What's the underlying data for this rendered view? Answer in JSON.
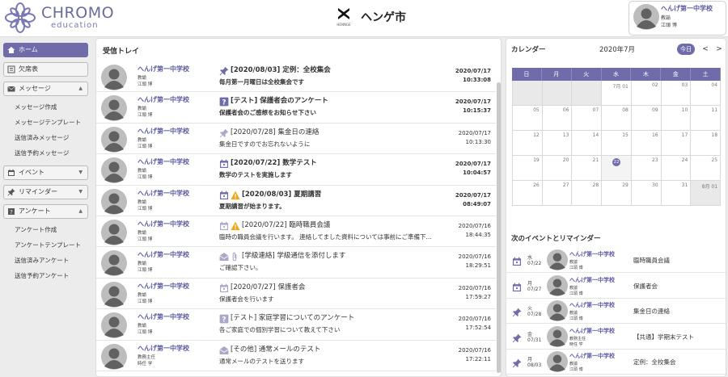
{
  "header": {
    "brand": "CHROMO",
    "brand_sub": "education",
    "city_sub": "HENNGE",
    "city_name": "ヘンゲ市",
    "user": {
      "school": "へんげ第一中学校",
      "role": "教諭",
      "person": "江頭 博"
    }
  },
  "sidebar": {
    "home": "ホーム",
    "attendance": "欠席表",
    "messages": "メッセージ",
    "message_items": [
      "メッセージ作成",
      "メッセージテンプレート",
      "送信済みメッセージ",
      "送信予約メッセージ"
    ],
    "events": "イベント",
    "reminders": "リマインダー",
    "surveys": "アンケート",
    "survey_items": [
      "アンケート作成",
      "アンケートテンプレート",
      "送信済みアンケート",
      "送信予約アンケート"
    ]
  },
  "inbox": {
    "title": "受信トレイ",
    "messages": [
      {
        "school": "へんげ第一中学校",
        "role": "教諭",
        "person": "江頭 博",
        "icons": [
          "pin-icon"
        ],
        "subject": "[2020/08/03] 定例：全校集会",
        "preview": "毎月第一月曜日は全校集会です",
        "date": "2020/07/17",
        "time": "10:33:08",
        "unread": true
      },
      {
        "school": "へんげ第一中学校",
        "role": "教諭",
        "person": "江頭 博",
        "icons": [
          "survey-icon"
        ],
        "subject": "[テスト] 保護者会のアンケート",
        "preview": "保護者会のご感想をお知らせ下さい",
        "date": "2020/07/17",
        "time": "10:15:37",
        "unread": true
      },
      {
        "school": "へんげ第一中学校",
        "role": "教諭",
        "person": "江頭 博",
        "icons": [
          "pin-icon"
        ],
        "subject": "[2020/07/28] 集金日の連絡",
        "preview": "集金日ですのでお忘れないように",
        "date": "2020/07/17",
        "time": "10:13:30",
        "unread": false
      },
      {
        "school": "へんげ第一中学校",
        "role": "教諭",
        "person": "江頭 博",
        "icons": [
          "calendar-icon"
        ],
        "subject": "[2020/07/22] 数学テスト",
        "preview": "数学のテストを実施します",
        "date": "2020/07/17",
        "time": "10:04:57",
        "unread": true
      },
      {
        "school": "へんげ第一中学校",
        "role": "教諭",
        "person": "江頭 博",
        "icons": [
          "calendar-icon",
          "warning-icon"
        ],
        "subject": "[2020/08/03] 夏期講習",
        "preview": "夏期講習が始まります。",
        "date": "2020/07/17",
        "time": "08:49:07",
        "unread": true
      },
      {
        "school": "へんげ第一中学校",
        "role": "教諭",
        "person": "江頭 博",
        "icons": [
          "calendar-icon",
          "warning-icon"
        ],
        "subject": "[2020/07/22] 臨時職員会議",
        "preview": "臨時の職員会議を行います。 連絡してました資料については事前にご準備下...",
        "date": "2020/07/16",
        "time": "18:44:35",
        "unread": false
      },
      {
        "school": "へんげ第一中学校",
        "role": "教諭",
        "person": "江頭 博",
        "icons": [
          "mail-icon",
          "attachment-icon"
        ],
        "subject": "[学級連絡] 学級通信を添付します",
        "preview": "ご確認下さい。",
        "date": "2020/07/16",
        "time": "18:29:51",
        "unread": false
      },
      {
        "school": "へんげ第一中学校",
        "role": "教諭",
        "person": "江頭 博",
        "icons": [
          "calendar-icon"
        ],
        "subject": "[2020/07/27] 保護者会",
        "preview": "保護者会を行います",
        "date": "2020/07/16",
        "time": "17:59:27",
        "unread": false
      },
      {
        "school": "へんげ第一中学校",
        "role": "教諭",
        "person": "江頭 博",
        "icons": [
          "survey-icon"
        ],
        "subject": "[テスト] 家庭学習についてのアンケート",
        "preview": "各ご家庭での個別学習について教えて下さい",
        "date": "2020/07/16",
        "time": "17:52:54",
        "unread": false
      },
      {
        "school": "へんげ第一中学校",
        "role": "教務主任",
        "person": "時任 学",
        "icons": [
          "mail-icon"
        ],
        "subject": "[その他] 通常メールのテスト",
        "preview": "通常メールのテストを送ります",
        "date": "2020/07/16",
        "time": "17:22:11",
        "unread": false
      }
    ]
  },
  "calendar": {
    "title": "カレンダー",
    "month": "2020年7月",
    "today_label": "今日",
    "prev": "<",
    "next": ">",
    "weekdays": [
      "日",
      "月",
      "火",
      "水",
      "木",
      "金",
      "土"
    ],
    "weeks": [
      [
        {
          "d": "",
          "out": true
        },
        {
          "d": "",
          "out": true
        },
        {
          "d": "",
          "out": true
        },
        {
          "d": "7月 01"
        },
        {
          "d": "02"
        },
        {
          "d": "03"
        },
        {
          "d": "04"
        }
      ],
      [
        {
          "d": "05"
        },
        {
          "d": "06"
        },
        {
          "d": "07"
        },
        {
          "d": "08"
        },
        {
          "d": "09"
        },
        {
          "d": "10"
        },
        {
          "d": "11"
        }
      ],
      [
        {
          "d": "12"
        },
        {
          "d": "13"
        },
        {
          "d": "14"
        },
        {
          "d": "15"
        },
        {
          "d": "16"
        },
        {
          "d": "17"
        },
        {
          "d": "18"
        }
      ],
      [
        {
          "d": "19"
        },
        {
          "d": "20"
        },
        {
          "d": "21"
        },
        {
          "d": "22",
          "today": true
        },
        {
          "d": "23"
        },
        {
          "d": "24"
        },
        {
          "d": "25"
        }
      ],
      [
        {
          "d": "26"
        },
        {
          "d": "27"
        },
        {
          "d": "28"
        },
        {
          "d": "29"
        },
        {
          "d": "30"
        },
        {
          "d": "31"
        },
        {
          "d": "8月 01",
          "out": true
        }
      ]
    ]
  },
  "events": {
    "title": "次のイベントとリマインダー",
    "items": [
      {
        "icon": "calendar-icon",
        "weekday": "水",
        "date": "07/22",
        "school": "へんげ第一中学校",
        "role": "教諭",
        "person": "江頭 博",
        "title": "臨時職員会議"
      },
      {
        "icon": "calendar-icon",
        "weekday": "月",
        "date": "07/27",
        "school": "へんげ第一中学校",
        "role": "教諭",
        "person": "江頭 博",
        "title": "保護者会"
      },
      {
        "icon": "pin-icon",
        "weekday": "火",
        "date": "07/28",
        "school": "へんげ第一中学校",
        "role": "教諭",
        "person": "江頭 博",
        "title": "集金日の連絡"
      },
      {
        "icon": "pin-icon",
        "weekday": "金",
        "date": "07/31",
        "school": "へんげ第一中学校",
        "role": "教務主任",
        "person": "時任 学",
        "title": "【共通】学期末テスト"
      },
      {
        "icon": "pin-icon",
        "weekday": "月",
        "date": "08/03",
        "school": "へんげ第一中学校",
        "role": "教諭",
        "person": "江頭 博",
        "title": "定例：全校集会"
      }
    ]
  },
  "colors": {
    "accent": "#6f6ca9",
    "school_text": "#5c5aa0",
    "warning": "#f0a818"
  }
}
